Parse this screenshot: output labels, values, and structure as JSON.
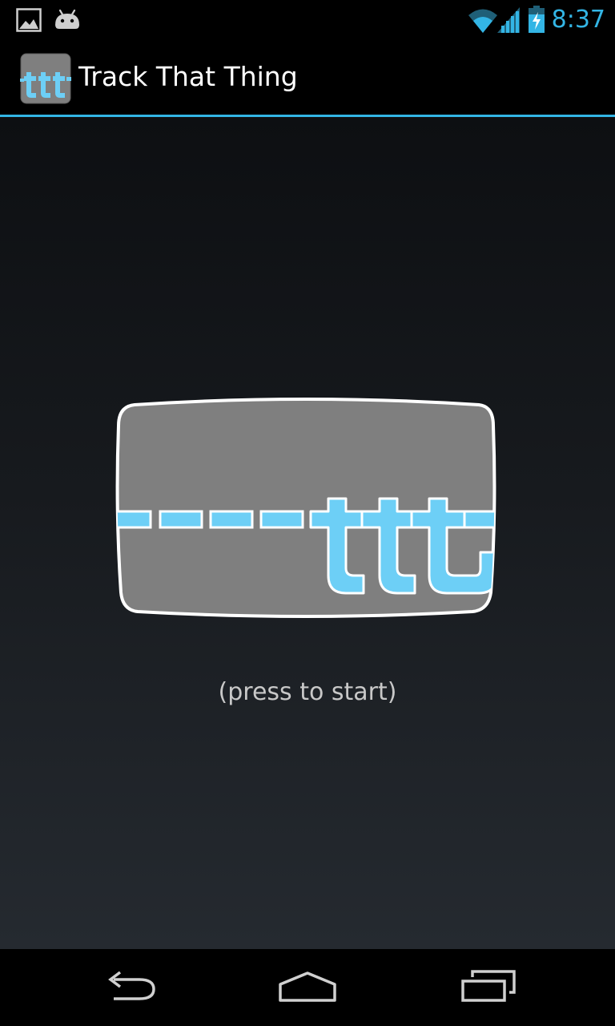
{
  "status_bar": {
    "time": "8:37",
    "notification_icons": [
      "gallery-icon",
      "android-icon"
    ],
    "system_icons": [
      "wifi-icon",
      "cell-signal-icon",
      "battery-charging-icon"
    ],
    "accent_color": "#33b5e5"
  },
  "action_bar": {
    "title": "Track That Thing",
    "app_icon": "ttt-app-icon"
  },
  "main": {
    "logo": {
      "text": "ttt",
      "icon": "ttt-logo-button",
      "fill_color": "#7f7f7f",
      "accent_color": "#6dcff6"
    },
    "hint": "(press to start)"
  },
  "nav_bar": {
    "buttons": [
      "back-icon",
      "home-icon",
      "recent-apps-icon"
    ]
  }
}
